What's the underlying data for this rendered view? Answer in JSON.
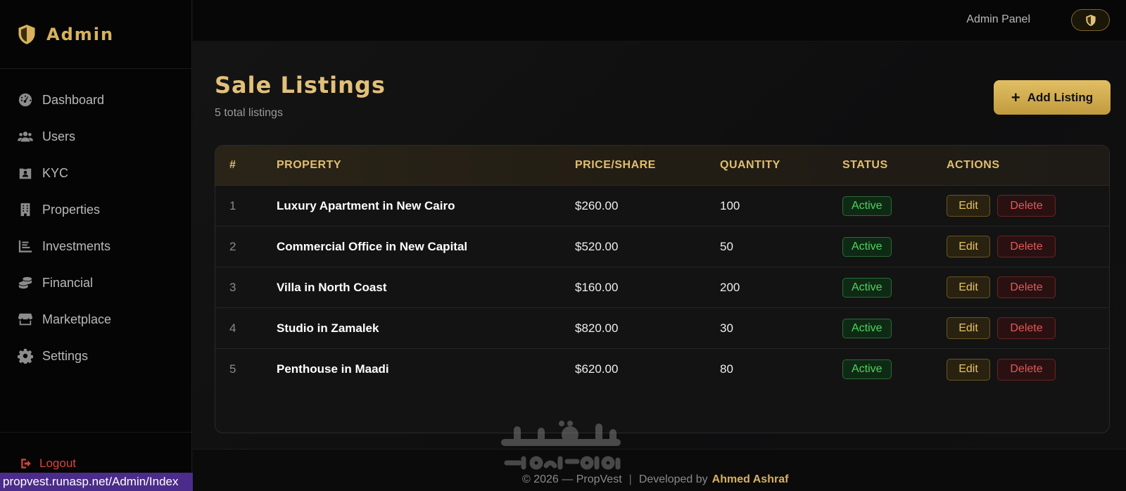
{
  "brand": {
    "name": "Admin",
    "logo_icon": "shield-icon"
  },
  "sidebar": {
    "items": [
      {
        "label": "Dashboard",
        "icon": "gauge-icon"
      },
      {
        "label": "Users",
        "icon": "users-icon"
      },
      {
        "label": "KYC",
        "icon": "id-card-icon"
      },
      {
        "label": "Properties",
        "icon": "building-icon"
      },
      {
        "label": "Investments",
        "icon": "chart-icon"
      },
      {
        "label": "Financial",
        "icon": "coins-icon"
      },
      {
        "label": "Marketplace",
        "icon": "store-icon"
      },
      {
        "label": "Settings",
        "icon": "gear-icon"
      }
    ],
    "logout_label": "Logout"
  },
  "topbar": {
    "admin_label": "Admin Panel"
  },
  "page": {
    "title": "Sale Listings",
    "subtitle": "5 total listings",
    "add_button_label": "Add Listing"
  },
  "table": {
    "headers": {
      "num": "#",
      "property": "PROPERTY",
      "price": "PRICE/SHARE",
      "quantity": "QUANTITY",
      "status": "STATUS",
      "actions": "ACTIONS"
    },
    "rows": [
      {
        "num": "1",
        "property": "Luxury Apartment in New Cairo",
        "price": "$260.00",
        "quantity": "100",
        "status": "Active",
        "edit": "Edit",
        "delete": "Delete"
      },
      {
        "num": "2",
        "property": "Commercial Office in New Capital",
        "price": "$520.00",
        "quantity": "50",
        "status": "Active",
        "edit": "Edit",
        "delete": "Delete"
      },
      {
        "num": "3",
        "property": "Villa in North Coast",
        "price": "$160.00",
        "quantity": "200",
        "status": "Active",
        "edit": "Edit",
        "delete": "Delete"
      },
      {
        "num": "4",
        "property": "Studio in Zamalek",
        "price": "$820.00",
        "quantity": "30",
        "status": "Active",
        "edit": "Edit",
        "delete": "Delete"
      },
      {
        "num": "5",
        "property": "Penthouse in Maadi",
        "price": "$620.00",
        "quantity": "80",
        "status": "Active",
        "edit": "Edit",
        "delete": "Delete"
      }
    ]
  },
  "footer": {
    "copyright": "© 2026 — PropVest",
    "developed_by": "Developed by",
    "author": "Ahmed Ashraf"
  },
  "status_bar": {
    "url": "propvest.runasp.net/Admin/Index"
  },
  "watermark": {
    "arabic": "مستقل",
    "latin": "mostaql.com"
  },
  "colors": {
    "accent": "#d9b25c",
    "active_green": "#4fd45f",
    "danger": "#e0595b",
    "background": "#0f0f10"
  }
}
